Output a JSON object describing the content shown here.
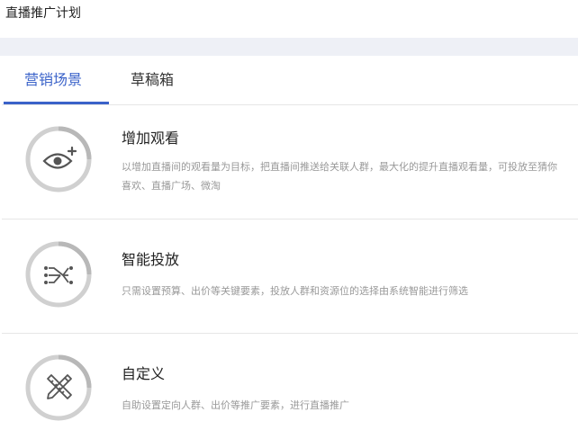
{
  "page": {
    "title": "直播推广计划"
  },
  "tabs": [
    {
      "label": "营销场景",
      "active": true
    },
    {
      "label": "草稿箱",
      "active": false
    }
  ],
  "scenarios": [
    {
      "title": "增加观看",
      "description": "以增加直播间的观看量为目标，把直播间推送给关联人群，最大化的提升直播观看量，可投放至猜你喜欢、直播广场、微淘",
      "icon": "eye-plus-icon"
    },
    {
      "title": "智能投放",
      "description": "只需设置预算、出价等关键要素，投放人群和资源位的选择由系统智能进行筛选",
      "icon": "routes-icon"
    },
    {
      "title": "自定义",
      "description": "自助设置定向人群、出价等推广要素，进行直播推广",
      "icon": "ruler-pencil-icon"
    }
  ],
  "colors": {
    "accent": "#3a62c9",
    "ring": "#cccccc",
    "ring_dark": "#b3b3b3",
    "icon": "#555555"
  }
}
